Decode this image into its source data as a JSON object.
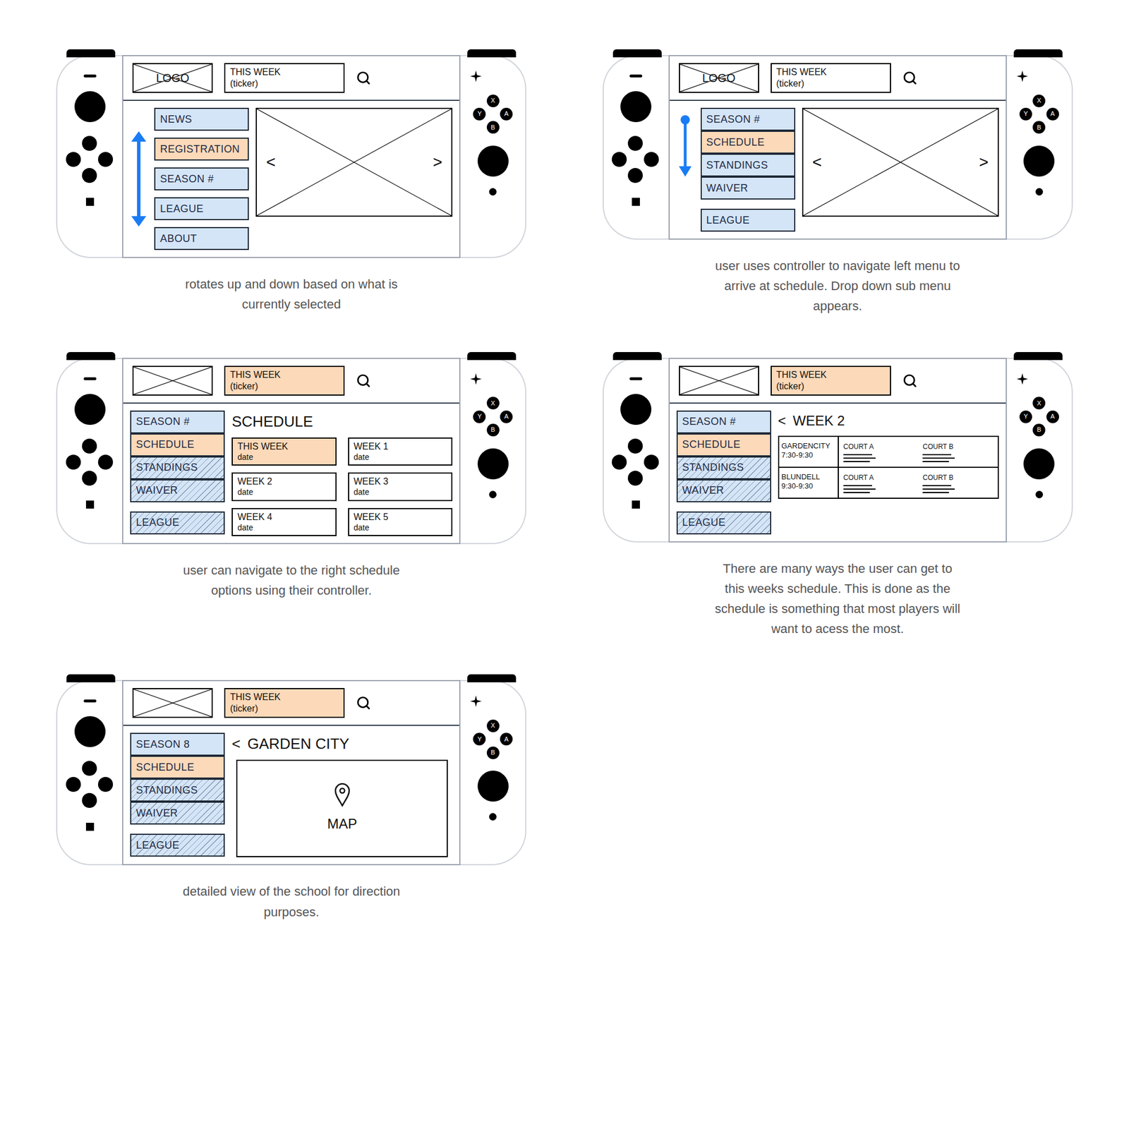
{
  "controller_buttons": [
    "X",
    "Y",
    "A",
    "B"
  ],
  "panels": [
    {
      "caption": "rotates up and down based on what is currently selected",
      "header": {
        "logo": "LOGO",
        "ticker": [
          "THIS WEEK",
          "(ticker)"
        ],
        "ticker_selected": false
      },
      "nav_arrow": "both",
      "menu": [
        [
          {
            "label": "NEWS",
            "selected": false,
            "hatched": false
          },
          {
            "label": "REGISTRATION",
            "selected": true,
            "hatched": false
          },
          {
            "label": "SEASON #",
            "selected": false,
            "hatched": false
          },
          {
            "label": "LEAGUE",
            "selected": false,
            "hatched": false
          },
          {
            "label": "ABOUT",
            "selected": false,
            "hatched": false
          }
        ]
      ],
      "content": {
        "kind": "carousel",
        "prev": "<",
        "next": ">"
      }
    },
    {
      "caption": "user uses controller to navigate left menu to arrive at schedule. Drop down sub menu appears.",
      "header": {
        "logo": "LOGO",
        "ticker": [
          "THIS WEEK",
          "(ticker)"
        ],
        "ticker_selected": false
      },
      "nav_arrow": "down",
      "menu": [
        [
          {
            "label": "SEASON #",
            "selected": false,
            "hatched": false
          },
          {
            "label": "SCHEDULE",
            "selected": true,
            "hatched": false
          },
          {
            "label": "STANDINGS",
            "selected": false,
            "hatched": false
          },
          {
            "label": "WAIVER",
            "selected": false,
            "hatched": false
          }
        ],
        [
          {
            "label": "LEAGUE",
            "selected": false,
            "hatched": false
          }
        ]
      ],
      "content": {
        "kind": "carousel",
        "prev": "<",
        "next": ">"
      }
    },
    {
      "caption": "user can navigate to the right schedule options using their controller.",
      "header": {
        "logo": "",
        "ticker": [
          "THIS WEEK",
          "(ticker)"
        ],
        "ticker_selected": true
      },
      "nav_arrow": "none",
      "menu": [
        [
          {
            "label": "SEASON #",
            "selected": false,
            "hatched": false
          },
          {
            "label": "SCHEDULE",
            "selected": true,
            "hatched": false
          },
          {
            "label": "STANDINGS",
            "selected": false,
            "hatched": true
          },
          {
            "label": "WAIVER",
            "selected": false,
            "hatched": true
          }
        ],
        [
          {
            "label": "LEAGUE",
            "selected": false,
            "hatched": true
          }
        ]
      ],
      "content": {
        "kind": "schedule_grid",
        "title": "SCHEDULE",
        "weeks": [
          {
            "label": "THIS WEEK",
            "date": "date",
            "selected": true
          },
          {
            "label": "WEEK 1",
            "date": "date",
            "selected": false
          },
          {
            "label": "WEEK 2",
            "date": "date",
            "selected": false
          },
          {
            "label": "WEEK 3",
            "date": "date",
            "selected": false
          },
          {
            "label": "WEEK 4",
            "date": "date",
            "selected": false
          },
          {
            "label": "WEEK 5",
            "date": "date",
            "selected": false
          }
        ]
      }
    },
    {
      "caption": "There are many ways the user can get to this weeks schedule. This is done as the schedule is something that most players will want to acess the most.",
      "header": {
        "logo": "",
        "ticker": [
          "THIS WEEK",
          "(ticker)"
        ],
        "ticker_selected": true
      },
      "nav_arrow": "none",
      "menu": [
        [
          {
            "label": "SEASON #",
            "selected": false,
            "hatched": false
          },
          {
            "label": "SCHEDULE",
            "selected": true,
            "hatched": false
          },
          {
            "label": "STANDINGS",
            "selected": false,
            "hatched": true
          },
          {
            "label": "WAIVER",
            "selected": false,
            "hatched": true
          }
        ],
        [
          {
            "label": "LEAGUE",
            "selected": false,
            "hatched": true
          }
        ]
      ],
      "content": {
        "kind": "week_detail",
        "back": "<",
        "title": "WEEK 2",
        "rows": [
          {
            "venue": "GARDENCITY",
            "time": "7:30-9:30",
            "courts": [
              "COURT A",
              "COURT B"
            ]
          },
          {
            "venue": "BLUNDELL",
            "time": "9:30-9:30",
            "courts": [
              "COURT A",
              "COURT B"
            ]
          }
        ]
      }
    },
    {
      "caption": "detailed view of the school for direction purposes.",
      "header": {
        "logo": "",
        "ticker": [
          "THIS WEEK",
          "(ticker)"
        ],
        "ticker_selected": true
      },
      "nav_arrow": "none",
      "menu": [
        [
          {
            "label": "SEASON 8",
            "selected": false,
            "hatched": false
          },
          {
            "label": "SCHEDULE",
            "selected": true,
            "hatched": false
          },
          {
            "label": "STANDINGS",
            "selected": false,
            "hatched": true
          },
          {
            "label": "WAIVER",
            "selected": false,
            "hatched": true
          }
        ],
        [
          {
            "label": "LEAGUE",
            "selected": false,
            "hatched": true
          }
        ]
      ],
      "content": {
        "kind": "map",
        "back": "<",
        "title": "GARDEN CITY",
        "label": "MAP"
      }
    }
  ]
}
